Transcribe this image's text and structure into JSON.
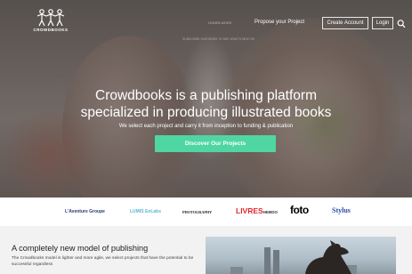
{
  "header": {
    "logo_text": "CROWDBOOKS",
    "faint_link": "LEARN MORE",
    "propose_link": "Propose your Project",
    "create_account": "Create Account",
    "login": "Login",
    "faint_sub": "SUBSCRIBE OUR NEWS TO SEE WHAT'S NEW ON"
  },
  "hero": {
    "headline_line1": "Crowdbooks is a publishing platform",
    "headline_line2": "specialized in producing illustrated books",
    "tagline": "We select each project and carry it from inception to funding & publication",
    "cta_label": "Discover Our Projects",
    "cta_color": "#4fd6a3"
  },
  "partners": {
    "items": [
      {
        "name": "L'Aventure Groupe"
      },
      {
        "name": "LUMIS EnLabs"
      },
      {
        "name": "PHOTOGRAPHY"
      },
      {
        "name": "LIVRES",
        "suffix": "HEBDO"
      },
      {
        "name": "foto"
      },
      {
        "name": "Stylus"
      }
    ]
  },
  "section": {
    "title": "A completely new model of publishing",
    "text": "The Crowdbooks model is lighter and more agile, we select projects that have the potential to be successful regardless"
  },
  "icons": {
    "logo": "people-logo-icon",
    "search": "search-icon"
  }
}
